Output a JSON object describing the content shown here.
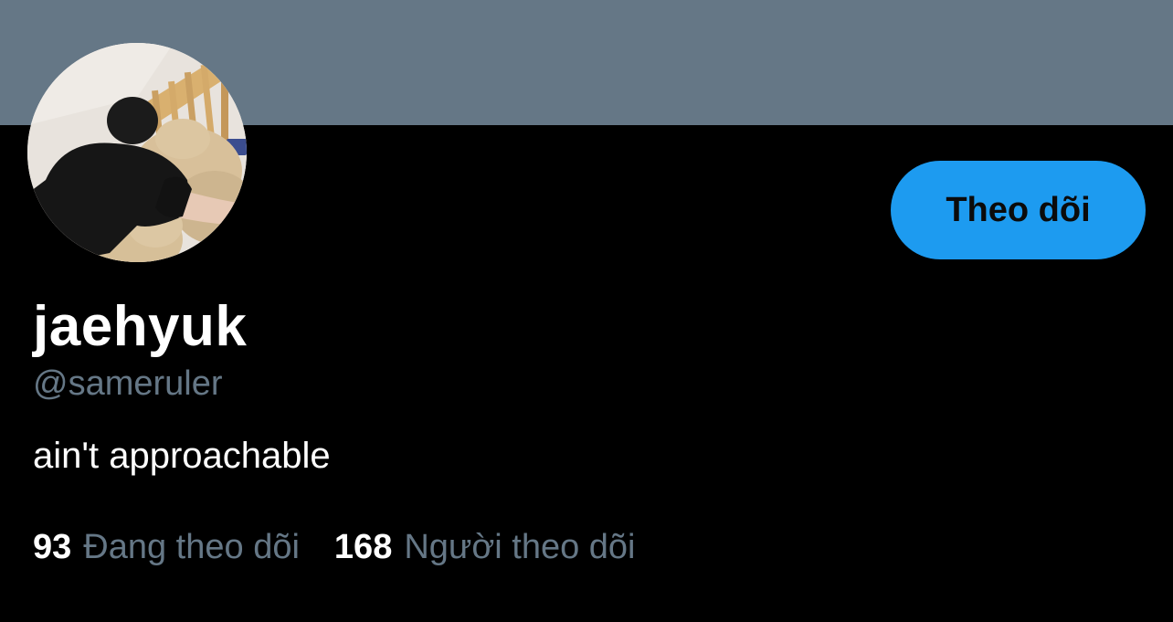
{
  "profile": {
    "display_name": "jaehyuk",
    "handle": "@sameruler",
    "bio": "ain't approachable",
    "follow_button_label": "Theo dõi"
  },
  "stats": {
    "following_count": "93",
    "following_label": "Đang theo dõi",
    "followers_count": "168",
    "followers_label": "Người theo dõi"
  },
  "colors": {
    "banner": "#657786",
    "background": "#000000",
    "accent": "#1d9bf0",
    "secondary_text": "#657786",
    "primary_text": "#ffffff"
  },
  "icons": {
    "avatar": "profile-photo"
  }
}
